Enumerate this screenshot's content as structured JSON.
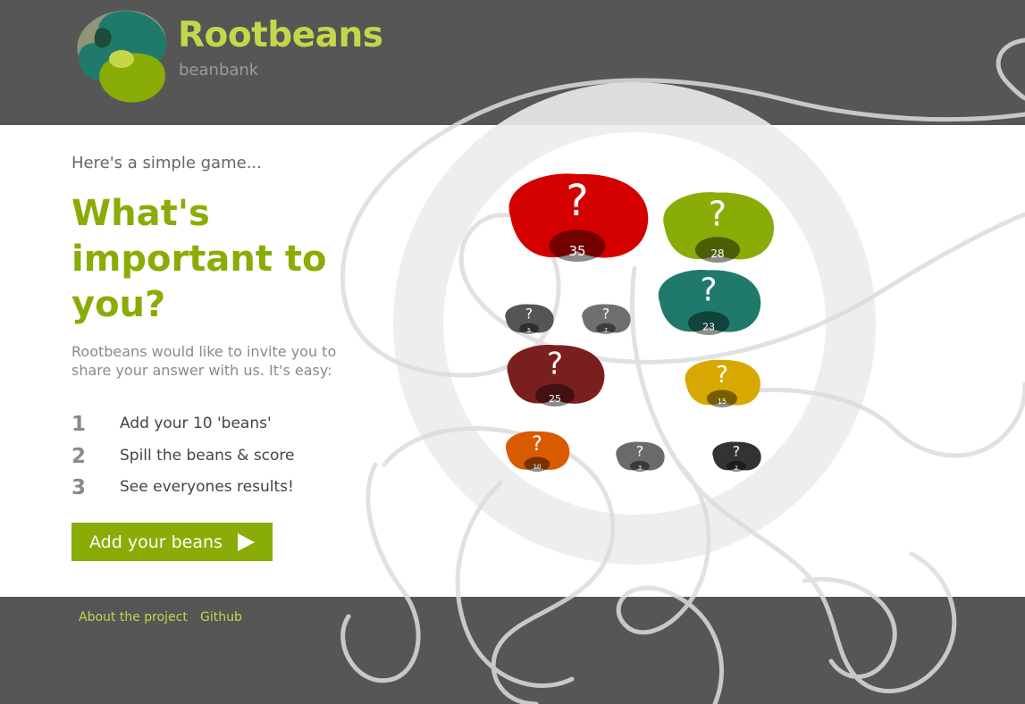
{
  "header": {
    "title": "Rootbeans",
    "subtitle": "beanbank"
  },
  "main": {
    "intro": "Here's a simple game...",
    "headline": "What's important to you?",
    "lead": "Rootbeans would like to invite you to share your answer with us. It's easy:",
    "steps": [
      {
        "number": "1",
        "label": "Add your 10 'beans'"
      },
      {
        "number": "2",
        "label": "Spill the beans & score"
      },
      {
        "number": "3",
        "label": "See everyones results!"
      }
    ],
    "cta_label": "Add your beans"
  },
  "beans": [
    {
      "mark": "?",
      "score": "35",
      "color": "#d40000"
    },
    {
      "mark": "?",
      "score": "28",
      "color": "#8aac07"
    },
    {
      "mark": "?",
      "score": "23",
      "color": "#1f7a6b"
    },
    {
      "mark": "?",
      "score": "5",
      "color": "#555555"
    },
    {
      "mark": "?",
      "score": "7",
      "color": "#6f6f6f"
    },
    {
      "mark": "?",
      "score": "25",
      "color": "#7a1f1f"
    },
    {
      "mark": "?",
      "score": "15",
      "color": "#d7a900"
    },
    {
      "mark": "?",
      "score": "10",
      "color": "#d95b00"
    },
    {
      "mark": "?",
      "score": "3",
      "color": "#6a6a6a"
    },
    {
      "mark": "?",
      "score": "2",
      "color": "#333333"
    }
  ],
  "footer": {
    "links": [
      "About the project",
      "Github"
    ]
  },
  "colors": {
    "brand_green": "#8aac07",
    "brand_lime": "#c4d64a",
    "header_bg": "#565656"
  }
}
